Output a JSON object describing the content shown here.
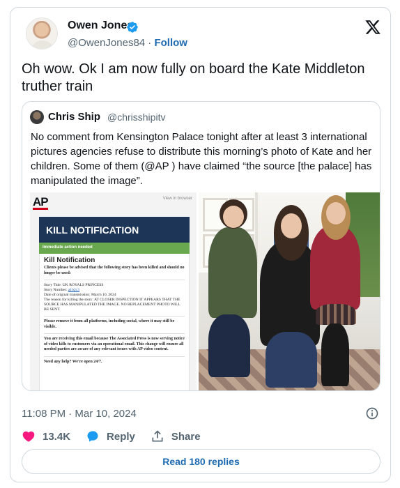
{
  "author": {
    "name": "Owen Jones",
    "handle": "@OwenJones84",
    "separator": "·",
    "follow_label": "Follow"
  },
  "tweet": {
    "text": "Oh wow. Ok I am now fully on board the Kate Middleton truther train"
  },
  "quoted": {
    "name": "Chris Ship",
    "handle": "@chrisshipitv",
    "text": "No comment from Kensington Palace tonight after at least 3 international pictures agencies refuse to distribute this morning’s photo of Kate and her children.  Some of them (@AP ) have claimed “the source [the palace] has manipulated the image”.",
    "email": {
      "logo": "AP",
      "view_link": "View in browser",
      "banner_title": "KILL NOTIFICATION",
      "action_bar": "Immediate action needed",
      "heading": "Kill Notification",
      "intro": "Clients please be advised that the following story has been killed and should no longer be used:",
      "story_title": "Story Title: UK ROYALS PRINCESS",
      "story_number_label": "Story Number:",
      "story_number": "a1b2c3",
      "date_line": "Date of original transmission: March 10, 2024",
      "reason": "The reason for killing the story: AT CLOSER INSPECTION IT APPEARS THAT THE SOURCE HAS MANIPULATED THE IMAGE. NO REPLACEMENT PHOTO WILL BE SENT.",
      "remove_note": "Please remove it from all platforms, including social, where it may still be visible.",
      "receiving_note": "You are receiving this email because The Associated Press is now serving notice of video kills to customers via an operational email. This change will ensure all needed parties are aware of any relevant issues with AP video content.",
      "help": "Need any help? We're open 24/7."
    }
  },
  "meta": {
    "timestamp": "11:08 PM · Mar 10, 2024"
  },
  "actions": {
    "likes": "13.4K",
    "reply_label": "Reply",
    "share_label": "Share"
  },
  "read_replies_label": "Read 180 replies",
  "colors": {
    "link_blue": "#1d6ab1",
    "verified_blue": "#1d9bf0",
    "like_pink": "#f91880",
    "muted_gray": "#536471",
    "border": "#cfd9de"
  }
}
